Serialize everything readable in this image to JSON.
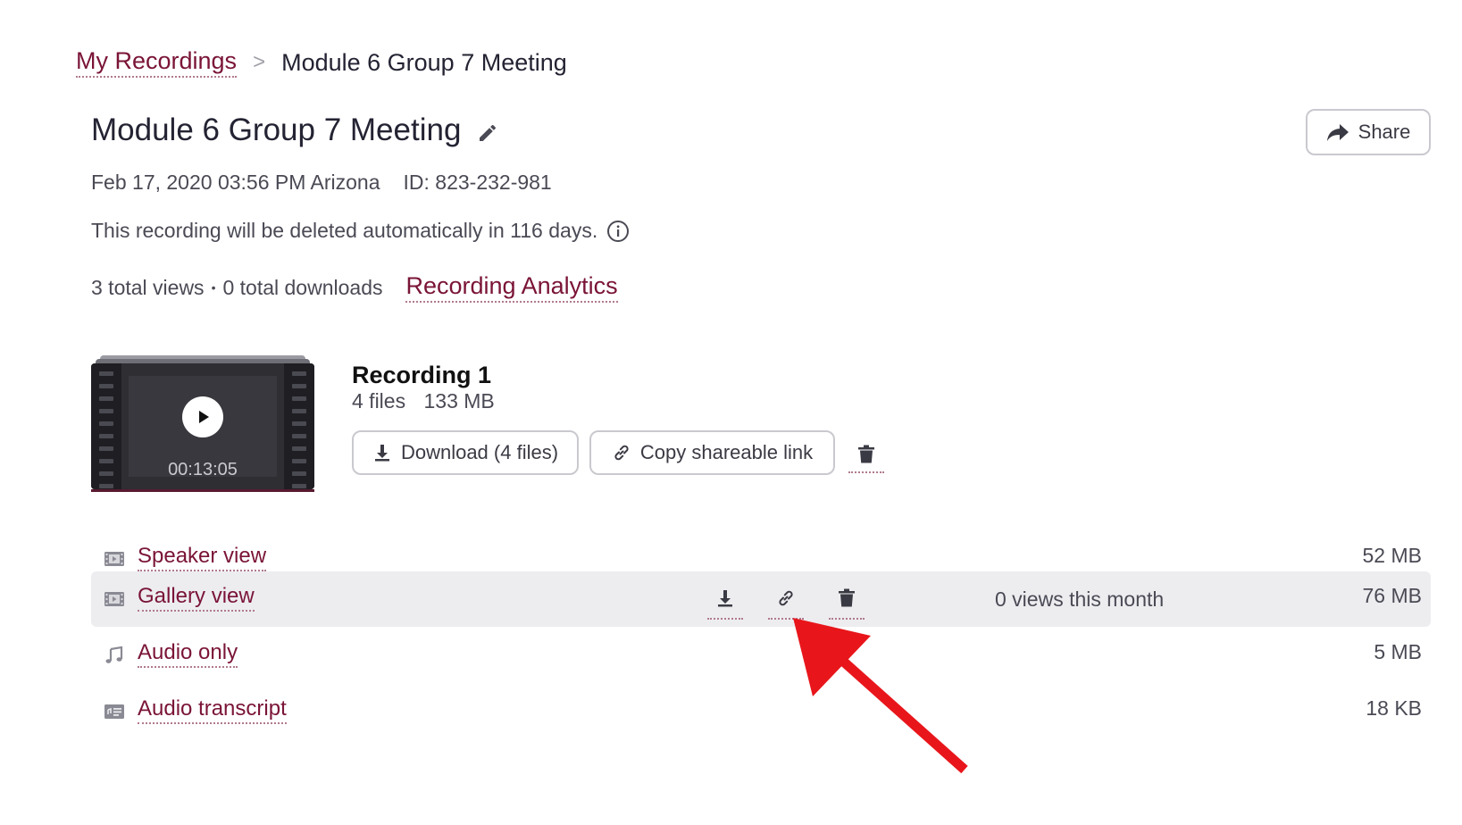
{
  "breadcrumb": {
    "root": "My Recordings",
    "separator": ">",
    "current": "Module 6 Group 7 Meeting"
  },
  "header": {
    "title": "Module 6 Group 7 Meeting",
    "edit_icon": "pencil-icon",
    "share_label": "Share",
    "share_icon": "share-arrow-icon"
  },
  "meta": {
    "date": "Feb 17, 2020 03:56 PM Arizona",
    "id": "ID: 823-232-981",
    "delete_notice": "This recording will be deleted automatically in 116 days.",
    "views": "3 total views",
    "dot": "•",
    "downloads": "0 total downloads",
    "analytics_link": "Recording Analytics"
  },
  "recording": {
    "title": "Recording 1",
    "files": "4 files",
    "size": "133 MB",
    "duration": "00:13:05",
    "download_label": "Download (4 files)",
    "copy_label": "Copy shareable link"
  },
  "files": [
    {
      "name": "Speaker view",
      "size": "52 MB",
      "icon": "film-icon"
    },
    {
      "name": "Gallery view",
      "size": "76 MB",
      "icon": "film-icon",
      "views": "0 views this month"
    },
    {
      "name": "Audio only",
      "size": "5 MB",
      "icon": "music-note-icon"
    },
    {
      "name": "Audio transcript",
      "size": "18 KB",
      "icon": "transcript-icon"
    }
  ],
  "colors": {
    "link": "#7a1437",
    "text": "#232333",
    "highlight_row": "#ededf0",
    "annotation_arrow": "#e8161b"
  }
}
